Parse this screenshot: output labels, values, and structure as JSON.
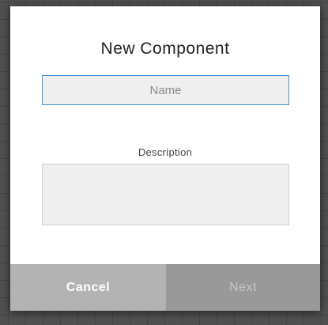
{
  "dialog": {
    "title": "New Component",
    "name_field": {
      "value": "",
      "placeholder": "Name"
    },
    "description_field": {
      "label": "Description",
      "value": ""
    },
    "buttons": {
      "cancel_label": "Cancel",
      "next_label": "Next"
    }
  },
  "colors": {
    "backdrop": "#505050",
    "dialog_background": "#ffffff",
    "input_background": "#efefef",
    "focus_border": "#3f8fd6",
    "cancel_button": "#b3b3b3",
    "next_button_disabled": "#999999"
  }
}
